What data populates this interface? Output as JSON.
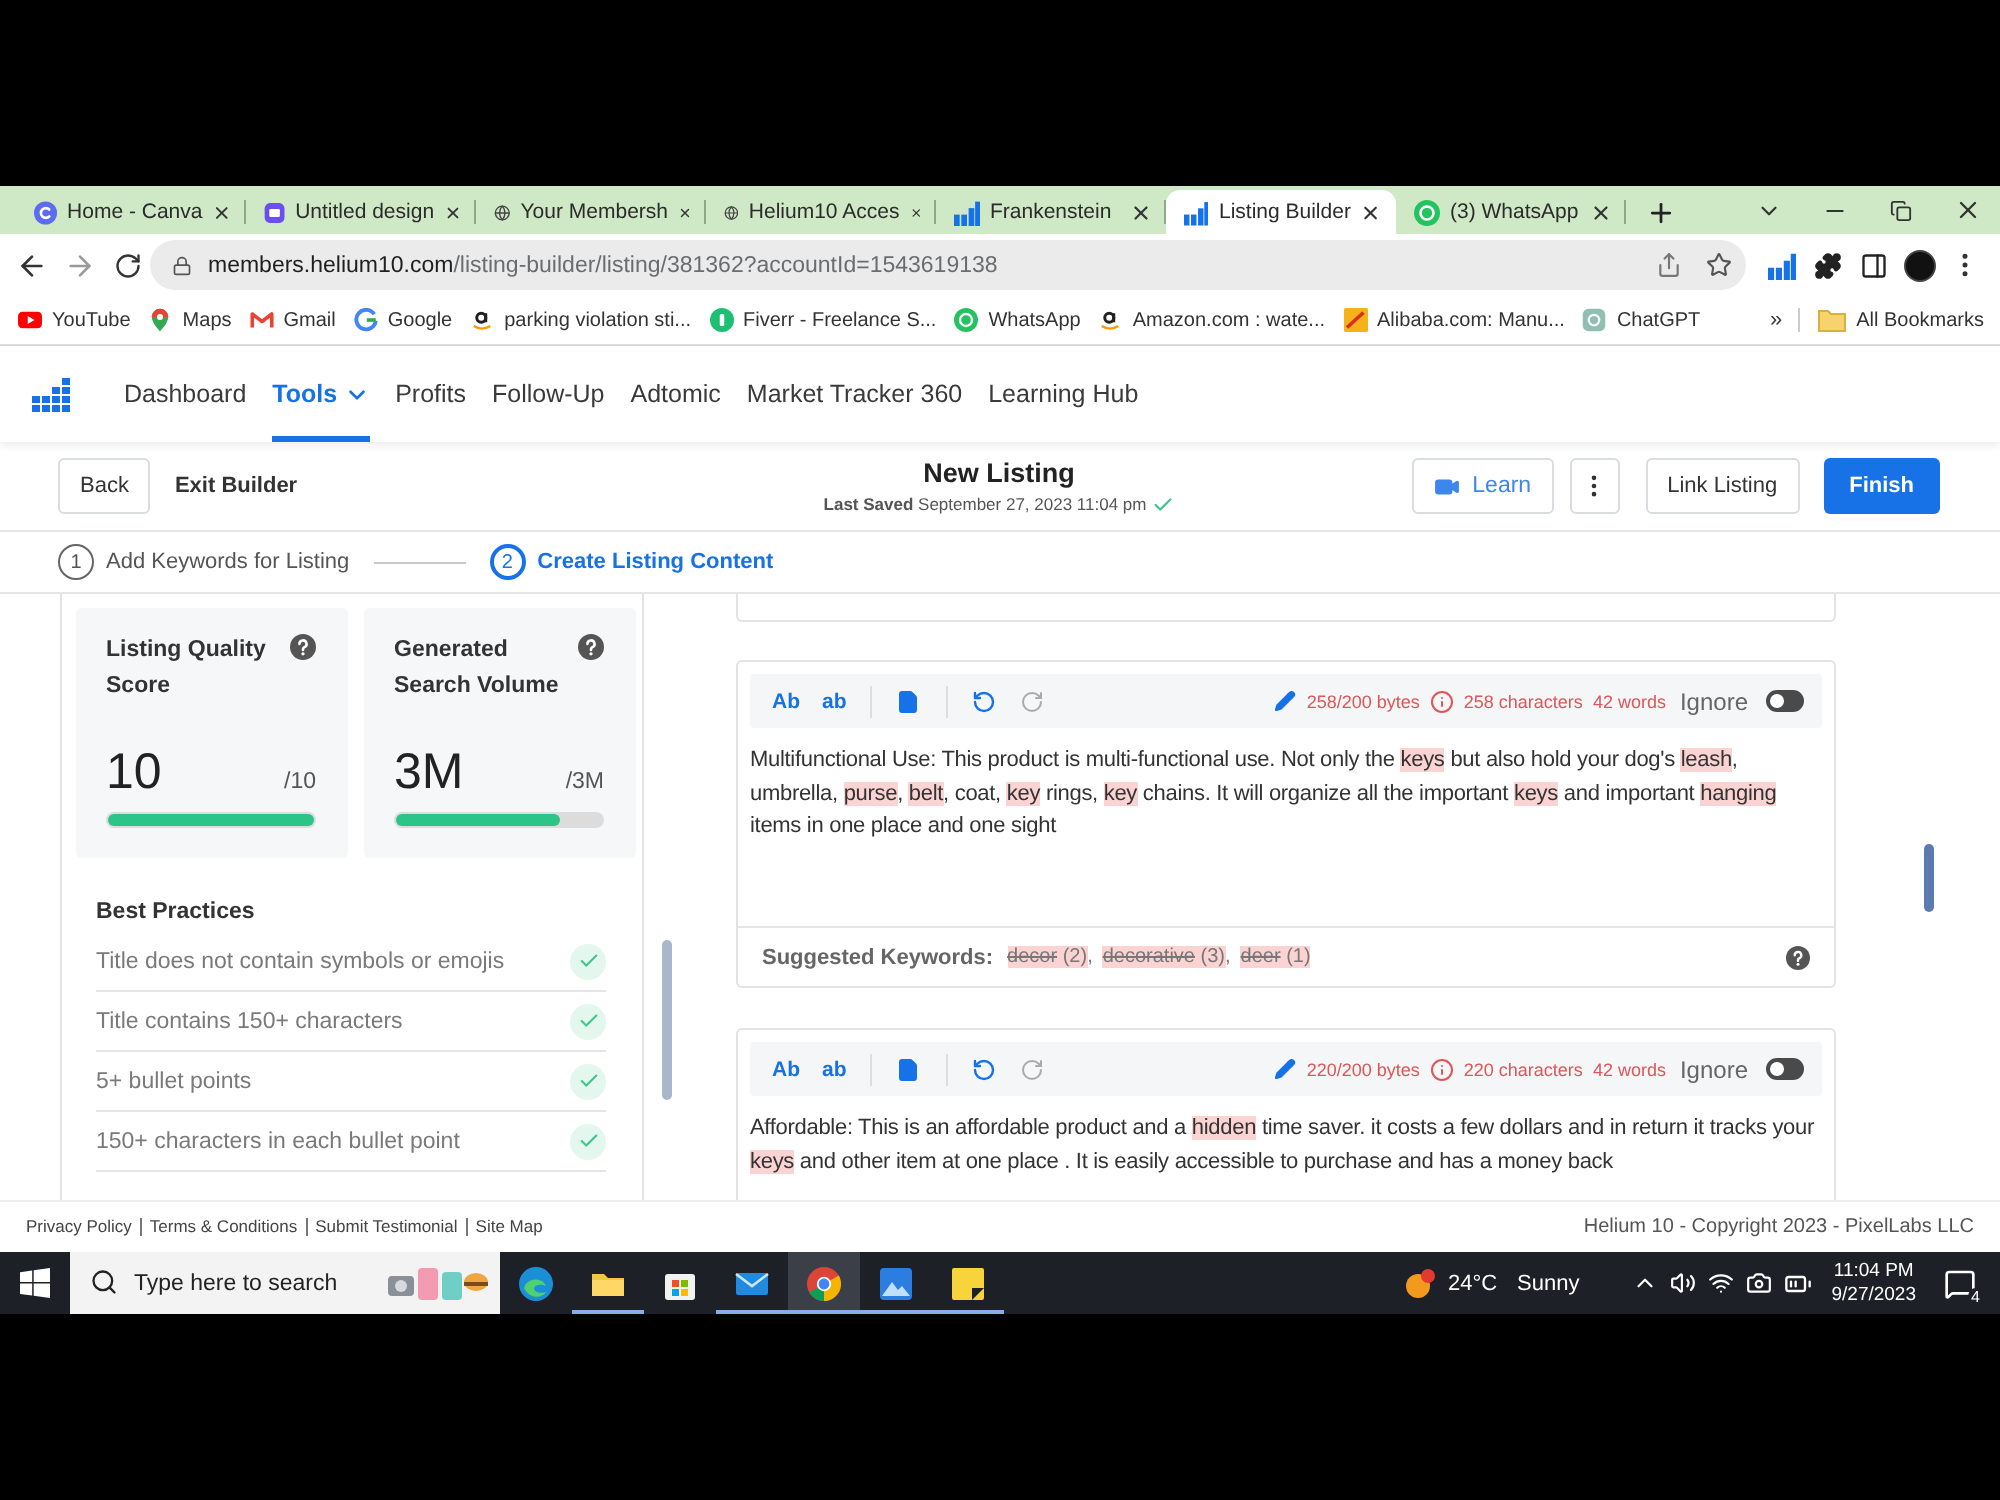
{
  "browser": {
    "tabs": [
      {
        "title": "Home - Canva",
        "kind": "canva",
        "selected": false
      },
      {
        "title": "Untitled design",
        "kind": "design",
        "selected": false
      },
      {
        "title": "Your Membersh",
        "kind": "globe",
        "selected": false
      },
      {
        "title": "Helium10 Acces",
        "kind": "globe",
        "selected": false
      },
      {
        "title": "Frankenstein",
        "kind": "helium",
        "selected": false
      },
      {
        "title": "Listing Builder",
        "kind": "helium",
        "selected": true
      },
      {
        "title": "(3) WhatsApp",
        "kind": "whatsapp",
        "selected": false
      }
    ],
    "url": {
      "domain": "members.helium10.com",
      "path": "/listing-builder/listing/381362?accountId=1543619138"
    },
    "bookmarks": [
      {
        "label": "YouTube",
        "kind": "youtube"
      },
      {
        "label": "Maps",
        "kind": "maps"
      },
      {
        "label": "Gmail",
        "kind": "gmail"
      },
      {
        "label": "Google",
        "kind": "google"
      },
      {
        "label": "parking violation sti...",
        "kind": "amazon"
      },
      {
        "label": "Fiverr - Freelance S...",
        "kind": "fiverr"
      },
      {
        "label": "WhatsApp",
        "kind": "whatsapp"
      },
      {
        "label": "Amazon.com : wate...",
        "kind": "amazon"
      },
      {
        "label": "Alibaba.com: Manu...",
        "kind": "alibaba"
      },
      {
        "label": "ChatGPT",
        "kind": "chatgpt"
      }
    ],
    "more_bookmarks": "»",
    "all_bookmarks": "All Bookmarks"
  },
  "app_nav": [
    {
      "label": "Dashboard",
      "selected": false,
      "dropdown": false
    },
    {
      "label": "Tools",
      "selected": true,
      "dropdown": true
    },
    {
      "label": "Profits",
      "selected": false,
      "dropdown": false
    },
    {
      "label": "Follow-Up",
      "selected": false,
      "dropdown": false
    },
    {
      "label": "Adtomic",
      "selected": false,
      "dropdown": false
    },
    {
      "label": "Market Tracker 360",
      "selected": false,
      "dropdown": false
    },
    {
      "label": "Learning Hub",
      "selected": false,
      "dropdown": false
    }
  ],
  "header": {
    "back": "Back",
    "exit": "Exit Builder",
    "title": "New Listing",
    "saved": "**Last Saved** September 27, 2023 11:04 pm",
    "learn": "Learn",
    "link_listing": "Link Listing",
    "finish": "Finish"
  },
  "steps": [
    {
      "number": "1",
      "label": "Add Keywords for Listing",
      "selected": false
    },
    {
      "number": "2",
      "label": "Create Listing Content",
      "selected": true
    }
  ],
  "scores": [
    {
      "title": "Listing Quality Score",
      "value": "10",
      "max": "/10",
      "level": 1.0
    },
    {
      "title": "Generated Search Volume",
      "value": "3M",
      "max": "/3M",
      "level": 0.8
    }
  ],
  "best_practices": {
    "title": "Best Practices",
    "items": [
      {
        "label": "Title does not contain symbols or emojis",
        "checked": true
      },
      {
        "label": "Title contains 150+ characters",
        "checked": true
      },
      {
        "label": "5+ bullet points",
        "checked": true
      },
      {
        "label": "150+ characters in each bullet point",
        "checked": true
      }
    ]
  },
  "bullets": [
    {
      "case_buttons": [
        "Ab",
        "ab"
      ],
      "bytes": "258/200 bytes",
      "characters": "258 characters",
      "words": "42 words",
      "ignore_label": "Ignore",
      "ignore": false,
      "text": [
        {
          "text": "Multifunctional Use: This product is multi-functional use. Not only the ",
          "highlight": false
        },
        {
          "text": "keys",
          "highlight": true
        },
        {
          "text": " but also hold your dog's ",
          "highlight": false
        },
        {
          "text": "leash",
          "highlight": true
        },
        {
          "text": ", umbrella, ",
          "highlight": false
        },
        {
          "text": "purse",
          "highlight": true
        },
        {
          "text": ", ",
          "highlight": false
        },
        {
          "text": "belt",
          "highlight": true
        },
        {
          "text": ", coat, ",
          "highlight": false
        },
        {
          "text": "key",
          "highlight": true
        },
        {
          "text": " rings, ",
          "highlight": false
        },
        {
          "text": "key",
          "highlight": true
        },
        {
          "text": " chains. It will organize all the important ",
          "highlight": false
        },
        {
          "text": "keys",
          "highlight": true
        },
        {
          "text": " and important ",
          "highlight": false
        },
        {
          "text": "hanging",
          "highlight": true
        },
        {
          "text": " items in one place and one sight",
          "highlight": false
        }
      ],
      "suggested": {
        "label": "Suggested Keywords:",
        "keywords": [
          {
            "word": "decor",
            "count": "(2)",
            "separator": ",",
            "used": true
          },
          {
            "word": "decorative",
            "count": "(3)",
            "separator": ",",
            "used": true
          },
          {
            "word": "deer",
            "count": "(1)",
            "used": true
          }
        ]
      }
    },
    {
      "case_buttons": [
        "Ab",
        "ab"
      ],
      "bytes": "220/200 bytes",
      "characters": "220 characters",
      "words": "42 words",
      "ignore_label": "Ignore",
      "ignore": false,
      "text": [
        {
          "text": "Affordable: This is an affordable product and a ",
          "highlight": false
        },
        {
          "text": "hidden",
          "highlight": true
        },
        {
          "text": " time saver. it costs a few dollars and in return it tracks your ",
          "highlight": false
        },
        {
          "text": "keys",
          "highlight": true
        },
        {
          "text": " and other item at one place . It is easily accessible to purchase and has a money back",
          "highlight": false
        }
      ]
    }
  ],
  "footer": {
    "links": [
      "Privacy Policy",
      "Terms & Conditions",
      "Submit Testimonial",
      "Site Map"
    ],
    "copyright": "Helium 10 - Copyright 2023 - PixelLabs LLC"
  },
  "taskbar": {
    "search": {
      "placeholder": "Type here to search"
    },
    "apps": [
      {
        "kind": "edge",
        "running": false,
        "selected": false
      },
      {
        "kind": "explorer",
        "running": true,
        "selected": false
      },
      {
        "kind": "store",
        "running": false,
        "selected": false
      },
      {
        "kind": "mail",
        "running": true,
        "selected": false
      },
      {
        "kind": "chrome",
        "running": true,
        "selected": true
      },
      {
        "kind": "photos",
        "running": true,
        "selected": false
      },
      {
        "kind": "sticky",
        "running": true,
        "selected": false
      }
    ],
    "temperature": "24°C",
    "weather": "Sunny",
    "time": "11:04 PM",
    "date": "9/27/2023",
    "notifications": "4"
  }
}
